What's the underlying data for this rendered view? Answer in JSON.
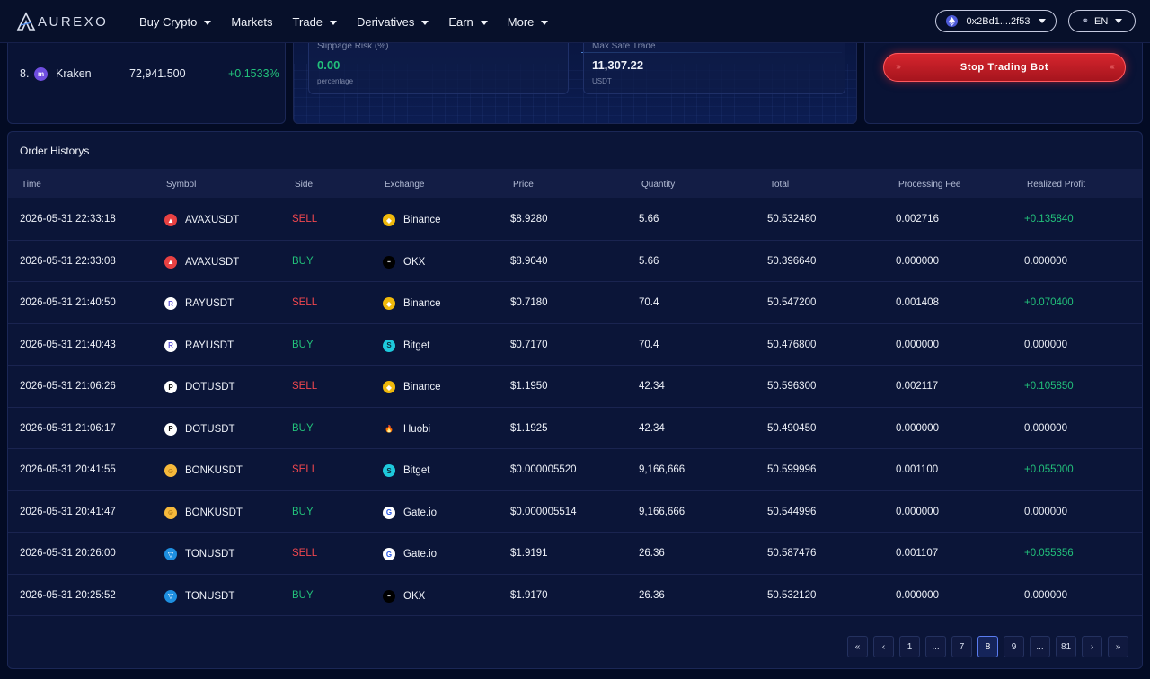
{
  "brand": {
    "name": "AUREXO"
  },
  "nav": {
    "items": [
      {
        "label": "Buy Crypto",
        "dropdown": true
      },
      {
        "label": "Markets",
        "dropdown": false
      },
      {
        "label": "Trade",
        "dropdown": true
      },
      {
        "label": "Derivatives",
        "dropdown": true
      },
      {
        "label": "Earn",
        "dropdown": true
      },
      {
        "label": "More",
        "dropdown": true
      }
    ],
    "wallet": "0x2Bd1....2f53",
    "language": "EN"
  },
  "exchange_ranking": {
    "row": {
      "rank": "8.",
      "name": "Kraken",
      "value": "72,941.500",
      "change": "+0.1533%"
    }
  },
  "risk_panel": {
    "slippage": {
      "label": "Slippage Risk (%)",
      "value": "0.00",
      "unit": "percentage"
    },
    "max_trade": {
      "label": "Max Safe Trade",
      "value": "11,307.22",
      "unit": "USDT"
    }
  },
  "bot": {
    "stop_label": "Stop Trading Bot"
  },
  "orders": {
    "title": "Order Historys",
    "columns": [
      "Time",
      "Symbol",
      "Side",
      "Exchange",
      "Price",
      "Quantity",
      "Total",
      "Processing Fee",
      "Realized Profit"
    ],
    "rows": [
      {
        "time": "2026-05-31 22:33:18",
        "symbol": "AVAXUSDT",
        "coin": "avax",
        "side": "SELL",
        "exchange": "Binance",
        "ex": "binance",
        "price": "$8.9280",
        "quantity": "5.66",
        "total": "50.532480",
        "fee": "0.002716",
        "profit": "+0.135840"
      },
      {
        "time": "2026-05-31 22:33:08",
        "symbol": "AVAXUSDT",
        "coin": "avax",
        "side": "BUY",
        "exchange": "OKX",
        "ex": "okx",
        "price": "$8.9040",
        "quantity": "5.66",
        "total": "50.396640",
        "fee": "0.000000",
        "profit": "0.000000"
      },
      {
        "time": "2026-05-31 21:40:50",
        "symbol": "RAYUSDT",
        "coin": "ray",
        "side": "SELL",
        "exchange": "Binance",
        "ex": "binance",
        "price": "$0.7180",
        "quantity": "70.4",
        "total": "50.547200",
        "fee": "0.001408",
        "profit": "+0.070400"
      },
      {
        "time": "2026-05-31 21:40:43",
        "symbol": "RAYUSDT",
        "coin": "ray",
        "side": "BUY",
        "exchange": "Bitget",
        "ex": "bitget",
        "price": "$0.7170",
        "quantity": "70.4",
        "total": "50.476800",
        "fee": "0.000000",
        "profit": "0.000000"
      },
      {
        "time": "2026-05-31 21:06:26",
        "symbol": "DOTUSDT",
        "coin": "dot",
        "side": "SELL",
        "exchange": "Binance",
        "ex": "binance",
        "price": "$1.1950",
        "quantity": "42.34",
        "total": "50.596300",
        "fee": "0.002117",
        "profit": "+0.105850"
      },
      {
        "time": "2026-05-31 21:06:17",
        "symbol": "DOTUSDT",
        "coin": "dot",
        "side": "BUY",
        "exchange": "Huobi",
        "ex": "huobi",
        "price": "$1.1925",
        "quantity": "42.34",
        "total": "50.490450",
        "fee": "0.000000",
        "profit": "0.000000"
      },
      {
        "time": "2026-05-31 20:41:55",
        "symbol": "BONKUSDT",
        "coin": "bonk",
        "side": "SELL",
        "exchange": "Bitget",
        "ex": "bitget",
        "price": "$0.000005520",
        "quantity": "9,166,666",
        "total": "50.599996",
        "fee": "0.001100",
        "profit": "+0.055000"
      },
      {
        "time": "2026-05-31 20:41:47",
        "symbol": "BONKUSDT",
        "coin": "bonk",
        "side": "BUY",
        "exchange": "Gate.io",
        "ex": "gate",
        "price": "$0.000005514",
        "quantity": "9,166,666",
        "total": "50.544996",
        "fee": "0.000000",
        "profit": "0.000000"
      },
      {
        "time": "2026-05-31 20:26:00",
        "symbol": "TONUSDT",
        "coin": "ton",
        "side": "SELL",
        "exchange": "Gate.io",
        "ex": "gate",
        "price": "$1.9191",
        "quantity": "26.36",
        "total": "50.587476",
        "fee": "0.001107",
        "profit": "+0.055356"
      },
      {
        "time": "2026-05-31 20:25:52",
        "symbol": "TONUSDT",
        "coin": "ton",
        "side": "BUY",
        "exchange": "OKX",
        "ex": "okx",
        "price": "$1.9170",
        "quantity": "26.36",
        "total": "50.532120",
        "fee": "0.000000",
        "profit": "0.000000"
      }
    ]
  },
  "pagination": {
    "items": [
      "«",
      "‹",
      "1",
      "...",
      "7",
      "8",
      "9",
      "...",
      "81",
      "›",
      "»"
    ],
    "current": "8"
  },
  "colors": {
    "sell": "#f0474e",
    "buy": "#22c07a",
    "profit": "#22c07a",
    "accent_red": "#d8262e"
  }
}
